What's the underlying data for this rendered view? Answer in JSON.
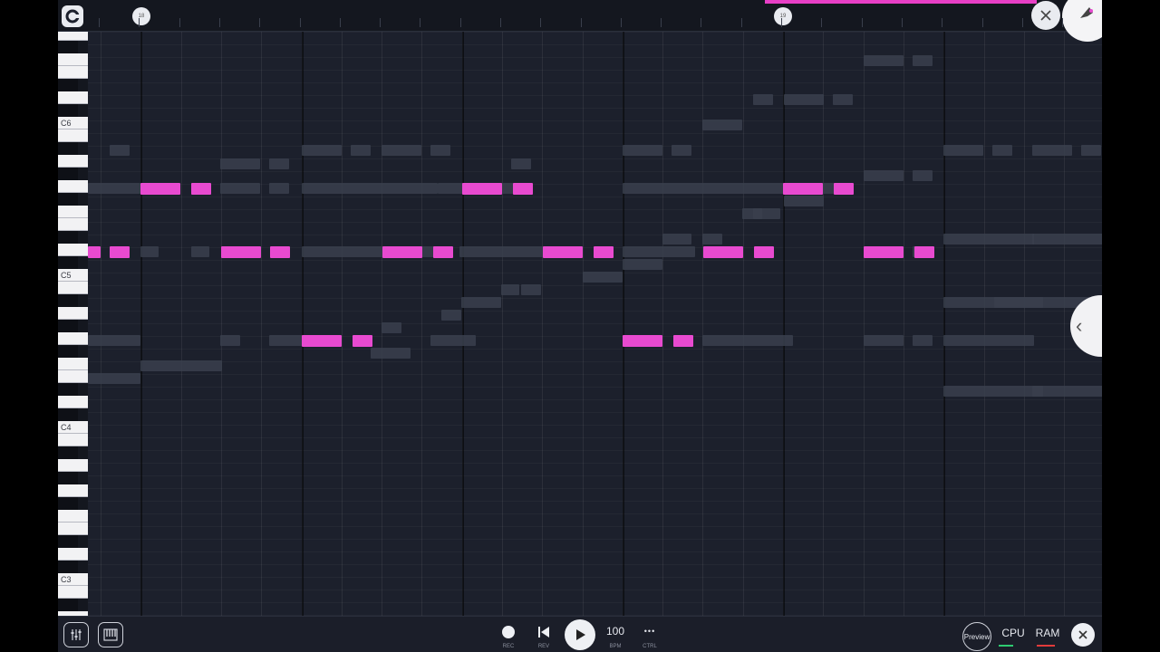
{
  "ruler": {
    "marker_start": "18",
    "marker_end": "19",
    "close_icon": "close-icon",
    "logo_icon": "app-logo-icon"
  },
  "keyboard": {
    "labels": [
      "C6",
      "C5",
      "C4",
      "C3"
    ]
  },
  "side_handle": {
    "icon": "chevron-left-icon",
    "glyph": "‹"
  },
  "transport": {
    "rec_label": "REC",
    "rev_label": "REV",
    "bpm_value": "100",
    "bpm_label": "BPM",
    "ctrl_label": "CTRL",
    "more_glyph": "•••"
  },
  "right_controls": {
    "preview_label": "Preview",
    "cpu_label": "CPU",
    "ram_label": "RAM"
  },
  "colors": {
    "accent": "#e84ad0",
    "ghost_note": "#3a3f4d",
    "background": "#1c202c",
    "cpu_meter": "#2ecc71",
    "ram_meter": "#e23b3b"
  }
}
